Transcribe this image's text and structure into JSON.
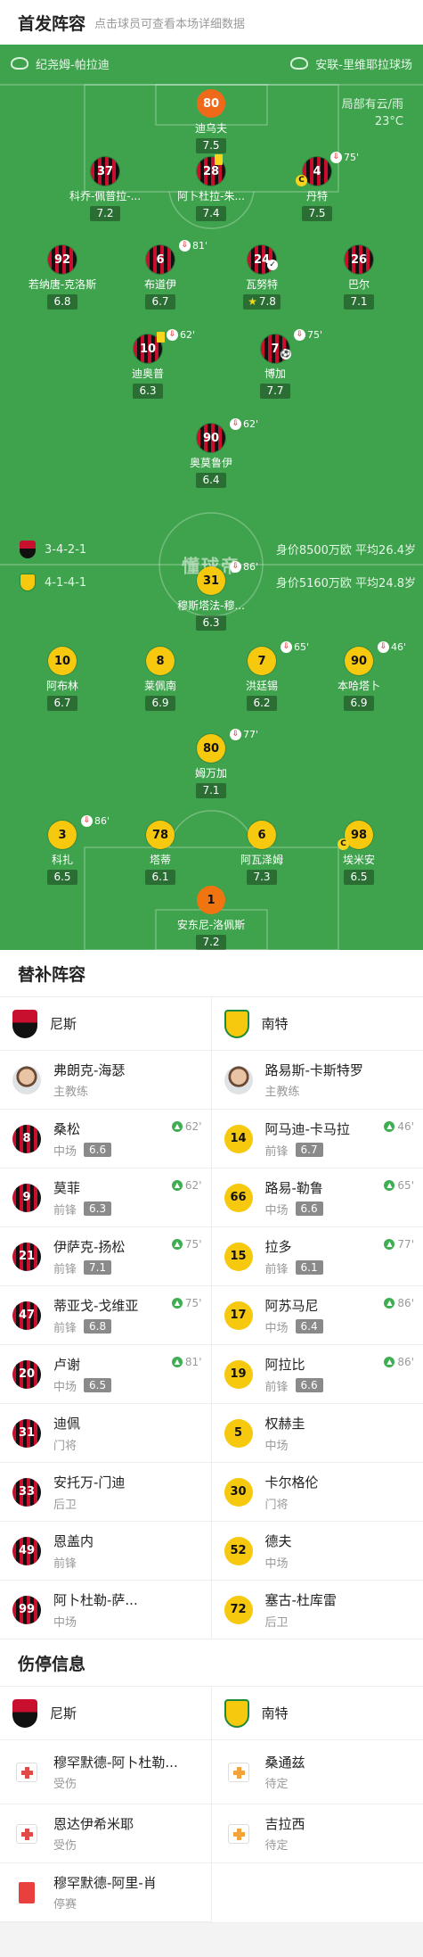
{
  "header": {
    "title": "首发阵容",
    "hint": "点击球员可查看本场详细数据"
  },
  "pitch": {
    "home_team": "纪尧姆-帕拉迪",
    "away_team": "安联-里维耶拉球场",
    "weather": "局部有云/雨",
    "temp": "23°C",
    "watermark": "懂球帝",
    "home_formation": "3-4-2-1",
    "home_value": "身价8500万欧 平均26.4岁",
    "away_formation": "4-1-4-1",
    "away_value": "身价5160万欧 平均24.8岁"
  },
  "home_players": [
    {
      "num": "80",
      "name": "迪乌夫",
      "rating": "7.5"
    },
    {
      "num": "37",
      "name": "科乔-佩普拉-...",
      "rating": "7.2"
    },
    {
      "num": "28",
      "name": "阿卜杜拉-朱...",
      "rating": "7.4"
    },
    {
      "num": "4",
      "name": "丹特",
      "rating": "7.5",
      "sub": "75'"
    },
    {
      "num": "92",
      "name": "若纳唐-克洛斯",
      "rating": "6.8"
    },
    {
      "num": "6",
      "name": "布道伊",
      "rating": "6.7",
      "sub": "81'"
    },
    {
      "num": "24",
      "name": "瓦努特",
      "rating": "7.8"
    },
    {
      "num": "26",
      "name": "巴尔",
      "rating": "7.1"
    },
    {
      "num": "10",
      "name": "迪奥普",
      "rating": "6.3",
      "sub": "62'"
    },
    {
      "num": "7",
      "name": "博加",
      "rating": "7.7",
      "sub": "75'"
    },
    {
      "num": "90",
      "name": "奥莫鲁伊",
      "rating": "6.4",
      "sub": "62'"
    }
  ],
  "away_players": [
    {
      "num": "31",
      "name": "穆斯塔法-穆...",
      "rating": "6.3",
      "sub": "86'"
    },
    {
      "num": "10",
      "name": "阿布林",
      "rating": "6.7"
    },
    {
      "num": "8",
      "name": "莱佩南",
      "rating": "6.9"
    },
    {
      "num": "7",
      "name": "洪廷锡",
      "rating": "6.2",
      "sub": "65'"
    },
    {
      "num": "90",
      "name": "本哈塔卜",
      "rating": "6.9",
      "sub": "46'"
    },
    {
      "num": "80",
      "name": "姆万加",
      "rating": "7.1",
      "sub": "77'"
    },
    {
      "num": "3",
      "name": "科扎",
      "rating": "6.5",
      "sub": "86'"
    },
    {
      "num": "78",
      "name": "塔蒂",
      "rating": "6.1"
    },
    {
      "num": "6",
      "name": "阿瓦泽姆",
      "rating": "7.3"
    },
    {
      "num": "98",
      "name": "埃米安",
      "rating": "6.5"
    },
    {
      "num": "1",
      "name": "安东尼-洛佩斯",
      "rating": "7.2"
    }
  ],
  "subs_section": {
    "title": "替补阵容"
  },
  "home_team_name": "尼斯",
  "away_team_name": "南特",
  "home_coach": {
    "name": "弗朗克-海瑟",
    "role": "主教练"
  },
  "away_coach": {
    "name": "路易斯-卡斯特罗",
    "role": "主教练"
  },
  "home_subs": [
    {
      "num": "8",
      "name": "桑松",
      "pos": "中场",
      "rating": "6.6",
      "in": "62'"
    },
    {
      "num": "9",
      "name": "莫菲",
      "pos": "前锋",
      "rating": "6.3",
      "in": "62'"
    },
    {
      "num": "21",
      "name": "伊萨克-扬松",
      "pos": "前锋",
      "rating": "7.1",
      "in": "75'"
    },
    {
      "num": "47",
      "name": "蒂亚戈-戈维亚",
      "pos": "前锋",
      "rating": "6.8",
      "in": "75'"
    },
    {
      "num": "20",
      "name": "卢谢",
      "pos": "中场",
      "rating": "6.5",
      "in": "81'"
    },
    {
      "num": "31",
      "name": "迪佩",
      "pos": "门将",
      "rating": "",
      "in": ""
    },
    {
      "num": "33",
      "name": "安托万-门迪",
      "pos": "后卫",
      "rating": "",
      "in": ""
    },
    {
      "num": "49",
      "name": "恩盖内",
      "pos": "前锋",
      "rating": "",
      "in": ""
    },
    {
      "num": "99",
      "name": "阿卜杜勒-萨...",
      "pos": "中场",
      "rating": "",
      "in": ""
    }
  ],
  "away_subs": [
    {
      "num": "14",
      "name": "阿马迪-卡马拉",
      "pos": "前锋",
      "rating": "6.7",
      "in": "46'"
    },
    {
      "num": "66",
      "name": "路易-勒鲁",
      "pos": "中场",
      "rating": "6.6",
      "in": "65'"
    },
    {
      "num": "15",
      "name": "拉多",
      "pos": "前锋",
      "rating": "6.1",
      "in": "77'"
    },
    {
      "num": "17",
      "name": "阿苏马尼",
      "pos": "中场",
      "rating": "6.4",
      "in": "86'"
    },
    {
      "num": "19",
      "name": "阿拉比",
      "pos": "前锋",
      "rating": "6.6",
      "in": "86'"
    },
    {
      "num": "5",
      "name": "权赫圭",
      "pos": "中场",
      "rating": "",
      "in": ""
    },
    {
      "num": "30",
      "name": "卡尔格伦",
      "pos": "门将",
      "rating": "",
      "in": ""
    },
    {
      "num": "52",
      "name": "德夫",
      "pos": "中场",
      "rating": "",
      "in": ""
    },
    {
      "num": "72",
      "name": "塞古-杜库雷",
      "pos": "后卫",
      "rating": "",
      "in": ""
    }
  ],
  "injury_section": {
    "title": "伤停信息"
  },
  "home_injuries": [
    {
      "name": "穆罕默德-阿卜杜勒...",
      "status": "受伤",
      "type": "red"
    },
    {
      "name": "恩达伊希米耶",
      "status": "受伤",
      "type": "red"
    },
    {
      "name": "穆罕默德-阿里-肖",
      "status": "停赛",
      "type": "card"
    }
  ],
  "away_injuries": [
    {
      "name": "桑通兹",
      "status": "待定",
      "type": "orange"
    },
    {
      "name": "吉拉西",
      "status": "待定",
      "type": "orange"
    }
  ]
}
